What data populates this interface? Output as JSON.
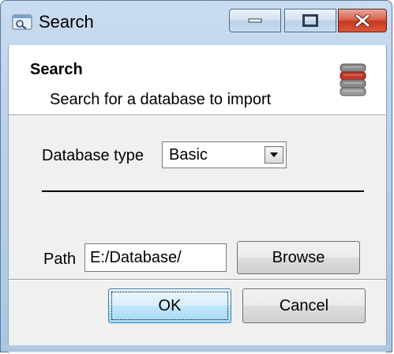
{
  "window": {
    "title": "Search",
    "icons": {
      "app": "search-window-icon",
      "minimize": "minimize-icon",
      "maximize": "maximize-icon",
      "close": "close-icon"
    },
    "colors": {
      "close": "#c4391f",
      "frame": "#b9d0ea"
    }
  },
  "header": {
    "title": "Search",
    "subtitle": "Search for a database to import",
    "icon": "database-icon"
  },
  "form": {
    "database_type_label": "Database type",
    "database_type_value": "Basic",
    "path_label": "Path",
    "path_value": "E:/Database/",
    "browse_label": "Browse"
  },
  "footer": {
    "ok_label": "OK",
    "cancel_label": "Cancel"
  }
}
